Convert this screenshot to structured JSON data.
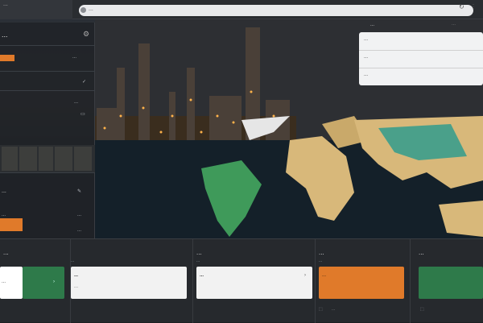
{
  "browser": {
    "tab_label": "...",
    "address": "..."
  },
  "left_panel": {
    "title": "...",
    "value1": "...",
    "value2": "...",
    "section": "...",
    "sub": "...",
    "row_a": "...",
    "row_b": "..."
  },
  "popover": {
    "header": "...",
    "items": [
      "...",
      "...",
      "..."
    ]
  },
  "bottom": {
    "col1": {
      "title": "...",
      "card_text": "..."
    },
    "col2": {
      "title": "...",
      "sub": "...",
      "card_title": "...",
      "card_line": "..."
    },
    "col3": {
      "title": "...",
      "sub": "...",
      "card_title": "...",
      "foot": "..."
    },
    "col4": {
      "title": "...",
      "sub": "...",
      "card_title": "...",
      "foot": "..."
    }
  },
  "colors": {
    "accent_orange": "#e07a2a",
    "accent_green": "#2e7a4a",
    "land_beige": "#d8b87a",
    "land_teal": "#4aa08a",
    "land_green": "#3f9a5a"
  }
}
